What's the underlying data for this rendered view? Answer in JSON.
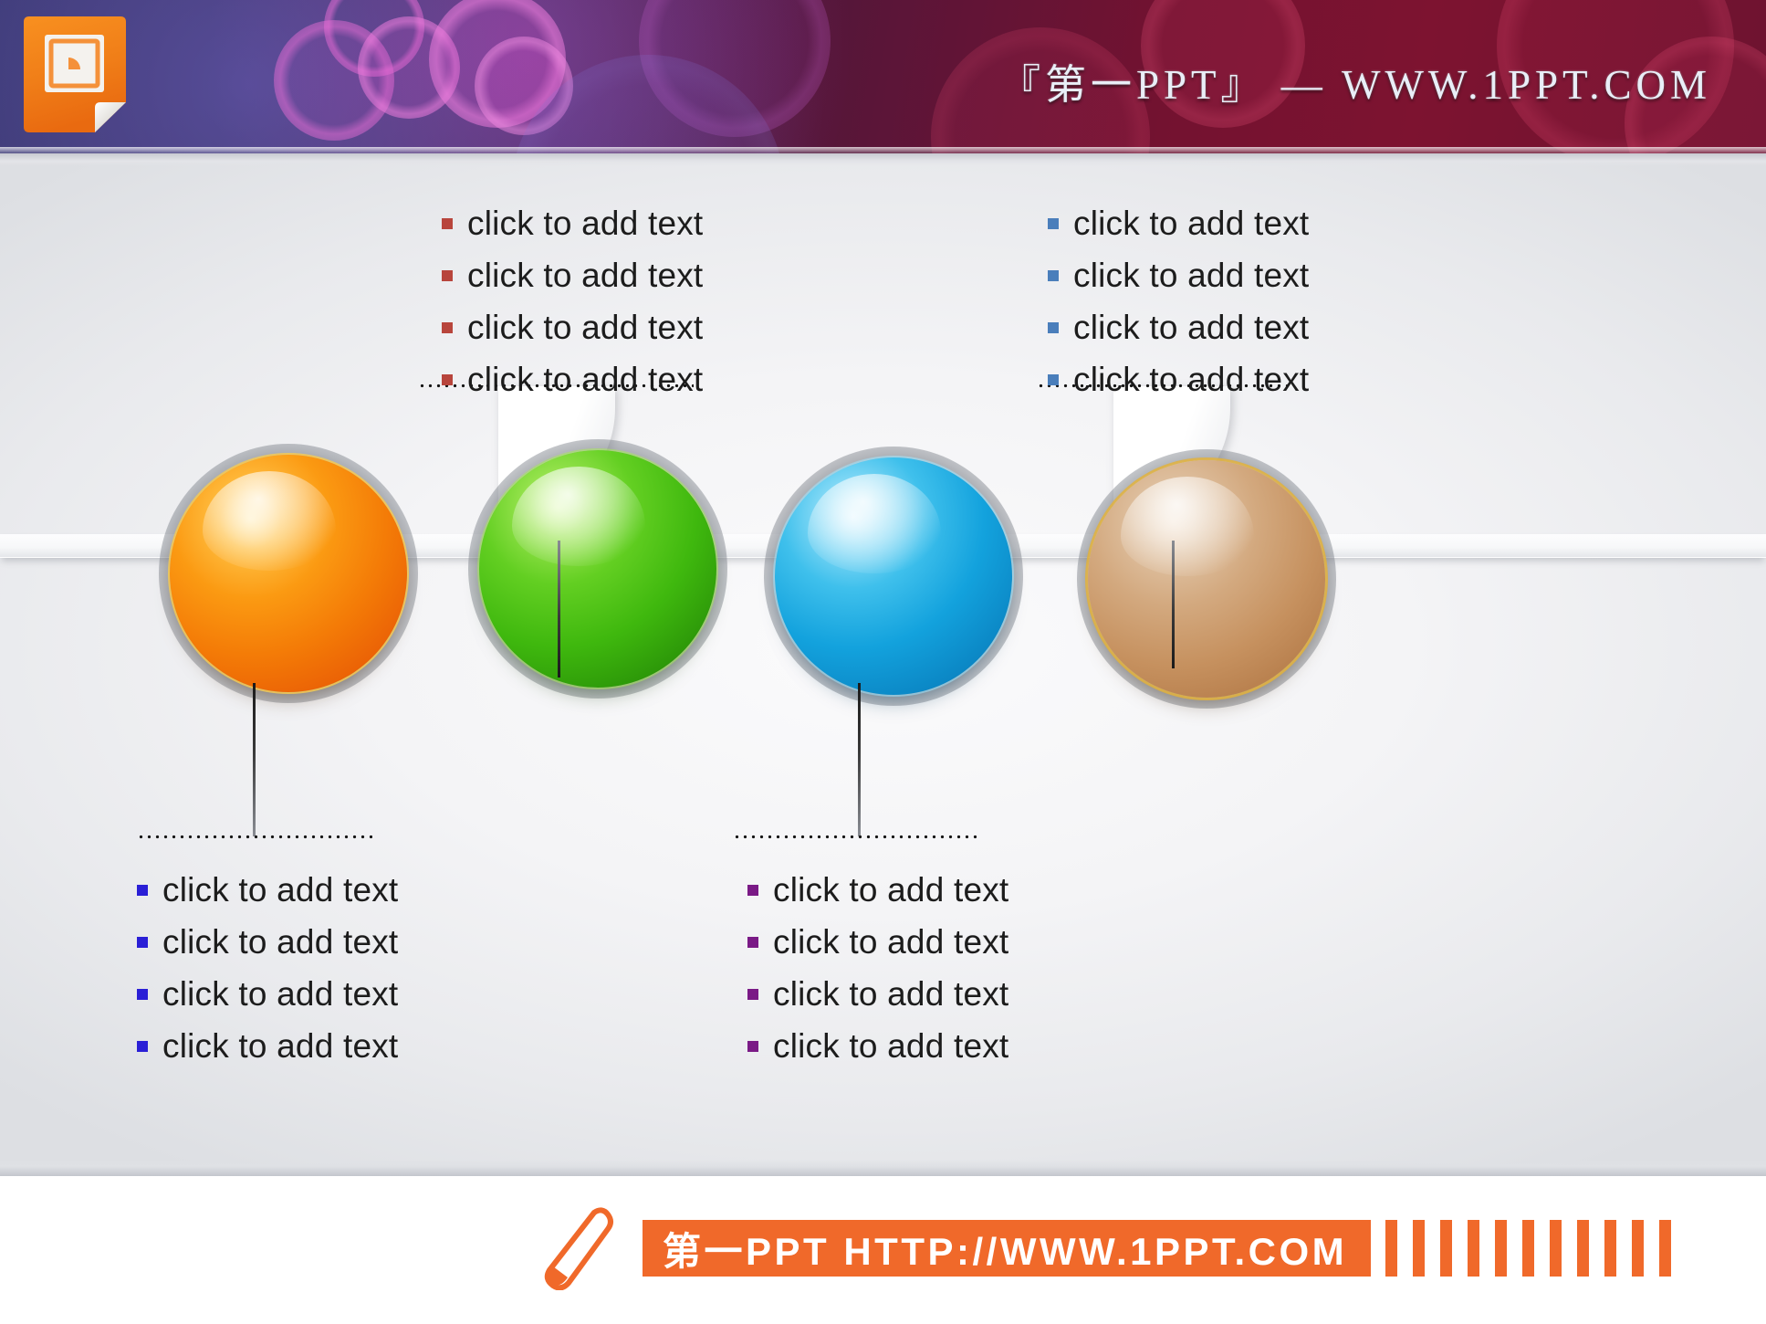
{
  "header": {
    "title": "『第一PPT』 — WWW.1PPT.COM",
    "logo_icon": "powerpoint-document-icon"
  },
  "slide": {
    "placeholder_label": "click to add text",
    "nodes": [
      {
        "id": "node-1",
        "sphere_color": "#f58220",
        "sphere_name": "orange-sphere",
        "label_position": "below",
        "bullet_color": "#2a1fd6",
        "items": [
          "click to add text",
          "click to add text",
          "click to add text",
          "click to add text"
        ]
      },
      {
        "id": "node-2",
        "sphere_color": "#4cbb17",
        "sphere_name": "green-sphere",
        "label_position": "above",
        "bullet_color": "#b8453c",
        "items": [
          "click to add text",
          "click to add text",
          "click to add text",
          "click to add text"
        ]
      },
      {
        "id": "node-3",
        "sphere_color": "#1c9ad6",
        "sphere_name": "blue-sphere",
        "label_position": "below",
        "bullet_color": "#7a1a86",
        "items": [
          "click to add text",
          "click to add text",
          "click to add text",
          "click to add text"
        ]
      },
      {
        "id": "node-4",
        "sphere_color": "#c08c5a",
        "sphere_name": "brown-sphere",
        "label_position": "above",
        "bullet_color": "#4a7ebb",
        "items": [
          "click to add text",
          "click to add text",
          "click to add text",
          "click to add text"
        ]
      }
    ]
  },
  "footer": {
    "url_text": "第一PPT HTTP://WWW.1PPT.COM",
    "pencil_icon": "pencil-icon",
    "accent_color": "#f0692a",
    "bar_count": 11
  }
}
